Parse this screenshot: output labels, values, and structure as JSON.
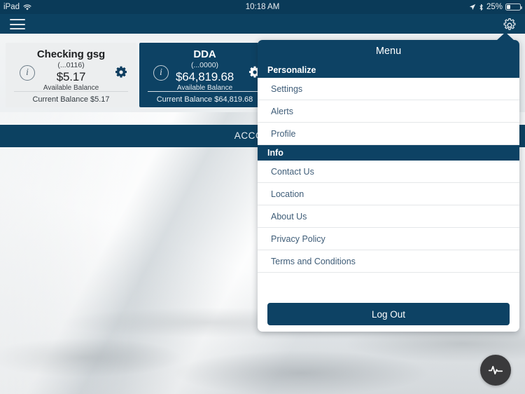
{
  "status_bar": {
    "device_label": "iPad",
    "wifi_icon": "wifi-icon",
    "time": "10:18 AM",
    "location_icon": "location-arrow-icon",
    "bluetooth_icon": "bluetooth-icon",
    "battery_percent": "25%",
    "battery_level": 25
  },
  "navbar": {
    "menu_icon": "hamburger-menu-icon",
    "gear_icon": "gear-icon",
    "background_color": "#0c4161"
  },
  "accounts": {
    "band_title": "ACCOUNTS",
    "cards": [
      {
        "name": "Checking gsg",
        "mask": "(...0116)",
        "available_amount": "$5.17",
        "available_label": "Available Balance",
        "current_balance": "Current Balance $5.17",
        "selected": false,
        "info_icon": "info-icon",
        "gear_icon": "gear-icon"
      },
      {
        "name": "DDA",
        "mask": "(...0000)",
        "available_amount": "$64,819.68",
        "available_label": "Available Balance",
        "current_balance": "Current Balance $64,819.68",
        "selected": true,
        "info_icon": "info-icon",
        "gear_icon": "gear-icon"
      }
    ]
  },
  "menu_popover": {
    "title": "Menu",
    "sections": [
      {
        "header": "Personalize",
        "items": [
          {
            "label": "Settings"
          },
          {
            "label": "Alerts"
          },
          {
            "label": "Profile"
          }
        ]
      },
      {
        "header": "Info",
        "items": [
          {
            "label": "Contact Us"
          },
          {
            "label": "Location"
          },
          {
            "label": "About Us"
          },
          {
            "label": "Privacy Policy"
          },
          {
            "label": "Terms and Conditions"
          }
        ]
      }
    ],
    "logout_label": "Log Out",
    "accent_color": "#0d4264"
  },
  "floating_action": {
    "icon": "pulse-waveform-icon",
    "background_color": "#3a3a3c"
  }
}
